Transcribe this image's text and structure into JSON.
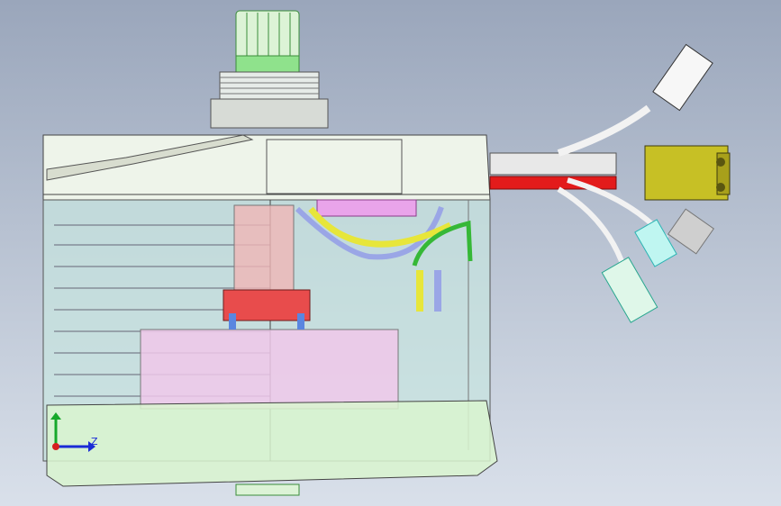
{
  "viewport": {
    "background_top": "#9aa6bb",
    "background_bottom": "#d9e0ea"
  },
  "triad": {
    "axis_label": "Z",
    "x_color": "#1a2bd6",
    "y_color": "#16a82a",
    "z_color": "#d62020"
  },
  "model": {
    "housing_color": "#c8e6e0",
    "cap_color": "#eef4ea",
    "wire_red": "#e31b1b",
    "wire_yellow": "#e7e63a",
    "wire_blue": "#9aa6e6",
    "wire_green": "#36b837",
    "connector_color": "#c7c025"
  }
}
